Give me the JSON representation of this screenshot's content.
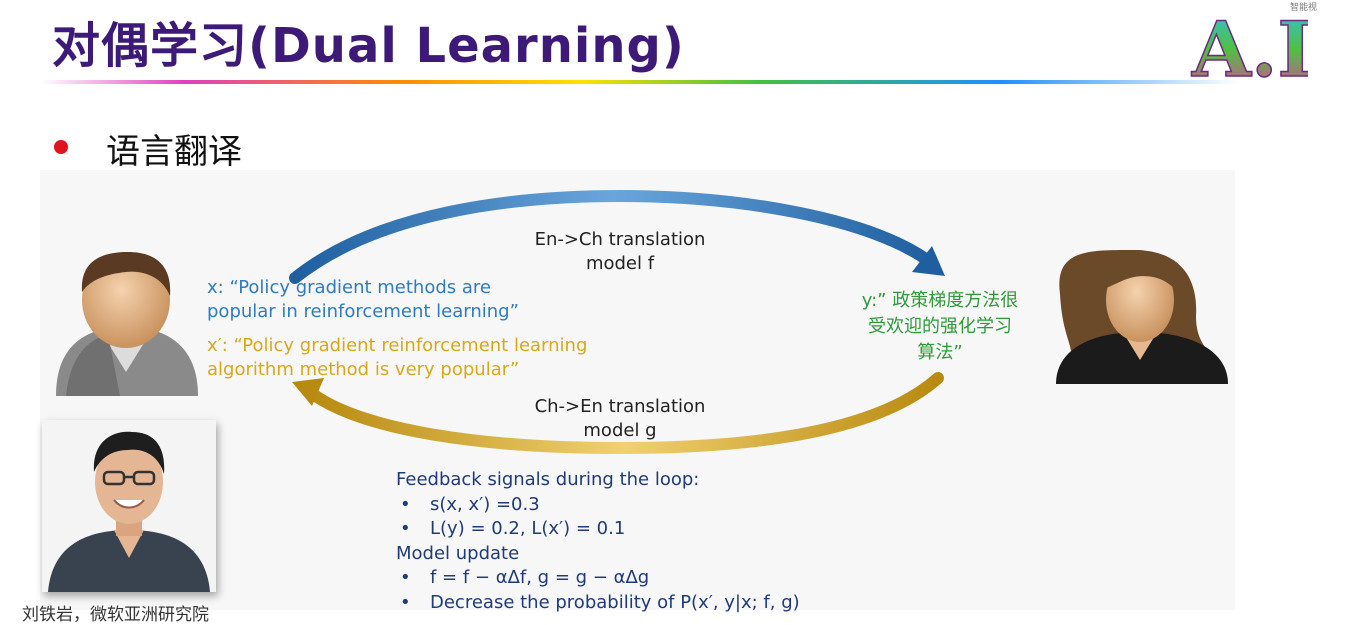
{
  "slide": {
    "title": "对偶学习(Dual Learning)",
    "bullet": "语言翻译",
    "corner_text": "智能视"
  },
  "logo": {
    "text": "A.I."
  },
  "diagram": {
    "top_model_line1": "En->Ch translation",
    "top_model_line2": "model f",
    "bottom_model_line1": "Ch->En translation",
    "bottom_model_line2": "model g",
    "x_line1": "x: “Policy gradient methods are",
    "x_line2": "popular in reinforcement learning”",
    "xprime_line1": "x′: “Policy gradient reinforcement learning",
    "xprime_line2": "algorithm method is very popular”",
    "y_line1": "y:” 政策梯度方法很",
    "y_line2": "受欢迎的强化学习",
    "y_line3": "算法”",
    "colors": {
      "blue_arrow": "#2e7bbf",
      "gold_arrow": "#d9a81a",
      "green_text": "#2f9a3a"
    }
  },
  "feedback": {
    "heading": "Feedback signals during the loop:",
    "items": [
      "s(x, x′) =0.3",
      "L(y) = 0.2,  L(x′) = 0.1"
    ],
    "update_heading": "Model update",
    "update_items": [
      "f = f − αΔf, g = g − αΔg",
      "Decrease the probability of P(x′, y|x; f, g)"
    ]
  },
  "presenter": {
    "caption": "刘铁岩，微软亚洲研究院"
  }
}
